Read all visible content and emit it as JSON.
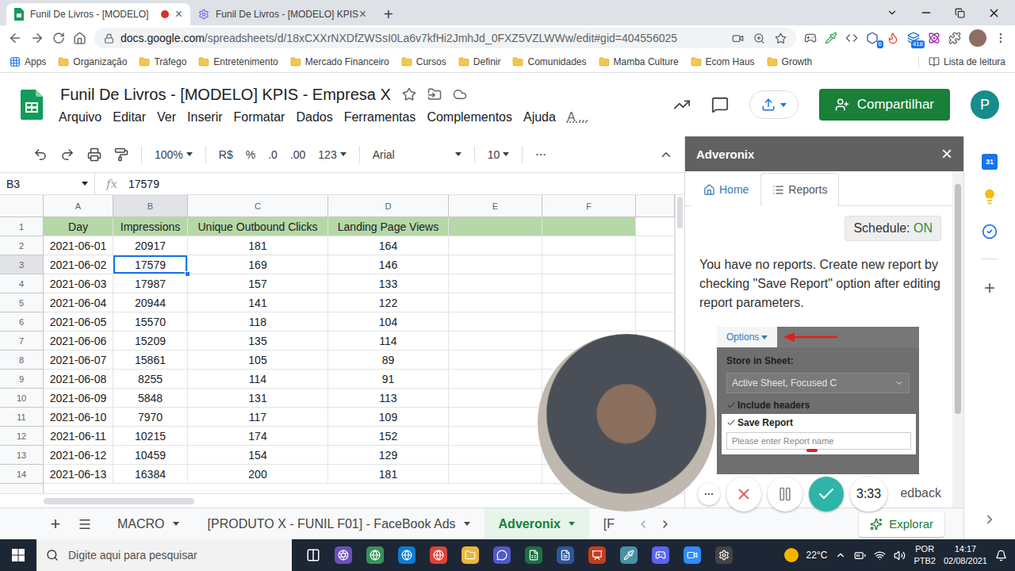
{
  "browser": {
    "tabs": [
      {
        "label": "Funil De Livros - [MODELO] ",
        "selected": true,
        "recording": true
      },
      {
        "label": "Funil De Livros - [MODELO] KPIS",
        "selected": false,
        "recording": false
      }
    ],
    "close": "×",
    "new_tab": "+",
    "url_host": "docs.google.com",
    "url_path": "/spreadsheets/d/18xCXXrNXDfZWSsI0La6v7kfHi2JmhJd_0FXZ5VZLWWw/edit#gid=404556025",
    "badges": [
      "6",
      "418"
    ],
    "apps": "Apps",
    "bookmarks": [
      "Organização",
      "Tráfego",
      "Entretenimento",
      "Mercado Financeiro",
      "Cursos",
      "Definir",
      "Comunidades",
      "Mamba Culture",
      "Ecom Haus",
      "Growth"
    ],
    "reading_list": "Lista de leitura"
  },
  "sheets": {
    "title": "Funil De Livros - [MODELO] KPIS - Empresa X",
    "menu": [
      "Arquivo",
      "Editar",
      "Ver",
      "Inserir",
      "Formatar",
      "Dados",
      "Ferramentas",
      "Complementos",
      "Ajuda",
      "A ..."
    ],
    "share": "Compartilhar",
    "avatar": "P"
  },
  "toolbar": {
    "zoom": "100%",
    "currency": "R$",
    "percent": "%",
    "decrease_decimals": ".0",
    "increase_decimals": ".00",
    "number_format": "123",
    "font": "Arial",
    "size": "10",
    "more": "⋯"
  },
  "formula_bar": {
    "cell": "B3",
    "fx": "fx",
    "value": "17579"
  },
  "grid": {
    "columns": [
      {
        "label": "A",
        "selected": false
      },
      {
        "label": "B",
        "selected": true
      },
      {
        "label": "C",
        "selected": false
      },
      {
        "label": "D",
        "selected": false
      },
      {
        "label": "E",
        "selected": false
      },
      {
        "label": "F",
        "selected": false
      }
    ],
    "rows": [
      {
        "number": "1",
        "kind": "header",
        "selected": false,
        "cells": [
          "Day",
          "Impressions",
          "Unique Outbound Clicks",
          "Landing Page Views",
          "",
          ""
        ]
      },
      {
        "number": "2",
        "kind": "data",
        "selected": false,
        "cells": [
          "2021-06-01",
          "20917",
          "181",
          "164",
          "",
          ""
        ]
      },
      {
        "number": "3",
        "kind": "data",
        "selected": true,
        "cells": [
          "2021-06-02",
          "17579",
          "169",
          "146",
          "",
          ""
        ]
      },
      {
        "number": "4",
        "kind": "data",
        "selected": false,
        "cells": [
          "2021-06-03",
          "17987",
          "157",
          "133",
          "",
          ""
        ]
      },
      {
        "number": "5",
        "kind": "data",
        "selected": false,
        "cells": [
          "2021-06-04",
          "20944",
          "141",
          "122",
          "",
          ""
        ]
      },
      {
        "number": "6",
        "kind": "data",
        "selected": false,
        "cells": [
          "2021-06-05",
          "15570",
          "118",
          "104",
          "",
          ""
        ]
      },
      {
        "number": "7",
        "kind": "data",
        "selected": false,
        "cells": [
          "2021-06-06",
          "15209",
          "135",
          "114",
          "",
          ""
        ]
      },
      {
        "number": "8",
        "kind": "data",
        "selected": false,
        "cells": [
          "2021-06-07",
          "15861",
          "105",
          "89",
          "",
          ""
        ]
      },
      {
        "number": "9",
        "kind": "data",
        "selected": false,
        "cells": [
          "2021-06-08",
          "8255",
          "114",
          "91",
          "",
          ""
        ]
      },
      {
        "number": "10",
        "kind": "data",
        "selected": false,
        "cells": [
          "2021-06-09",
          "5848",
          "131",
          "113",
          "",
          ""
        ]
      },
      {
        "number": "11",
        "kind": "data",
        "selected": false,
        "cells": [
          "2021-06-10",
          "7970",
          "117",
          "109",
          "",
          ""
        ]
      },
      {
        "number": "12",
        "kind": "data",
        "selected": false,
        "cells": [
          "2021-06-11",
          "10215",
          "174",
          "152",
          "",
          ""
        ]
      },
      {
        "number": "13",
        "kind": "data",
        "selected": false,
        "cells": [
          "2021-06-12",
          "10459",
          "154",
          "129",
          "",
          ""
        ]
      },
      {
        "number": "14",
        "kind": "data",
        "selected": false,
        "cells": [
          "2021-06-13",
          "16384",
          "200",
          "181",
          "",
          ""
        ]
      }
    ]
  },
  "sidebar": {
    "title": "Adveronix",
    "close": "×",
    "tabs": [
      {
        "label": "Home",
        "selected": false
      },
      {
        "label": "Reports",
        "selected": true
      }
    ],
    "schedule_label": "Schedule: ",
    "schedule_value": "ON",
    "schedule_on": true,
    "message": "You have no reports. Create new report by checking \"Save Report\" option after editing report parameters.",
    "guide": {
      "options": "Options",
      "store_label": "Store in Sheet:",
      "store_value": "Active Sheet, Focused C",
      "include_headers": {
        "label": "Include headers",
        "checked": true
      },
      "save_report": {
        "label": "Save Report",
        "checked": true
      },
      "report_placeholder": "Please enter Report name"
    },
    "feedback": "edback"
  },
  "side_apps": {
    "calendar_day": "31",
    "add": "+"
  },
  "sheet_tabs": {
    "add": "+",
    "tabs": [
      {
        "label": "MACRO",
        "selected": false,
        "caret": true
      },
      {
        "label": "[PRODUTO X - FUNIL F01] - FaceBook Ads",
        "selected": false,
        "caret": true
      },
      {
        "label": "Adveronix",
        "selected": true,
        "caret": true
      },
      {
        "label": "[F",
        "selected": false,
        "caret": false
      }
    ],
    "explore": "Explorar"
  },
  "recorder": {
    "time": "3:33"
  },
  "taskbar": {
    "search": "Digite aqui para pesquisar",
    "weather": "22°C",
    "language": [
      "POR",
      "PTB2"
    ],
    "time": "14:17",
    "date": "02/08/2021"
  }
}
